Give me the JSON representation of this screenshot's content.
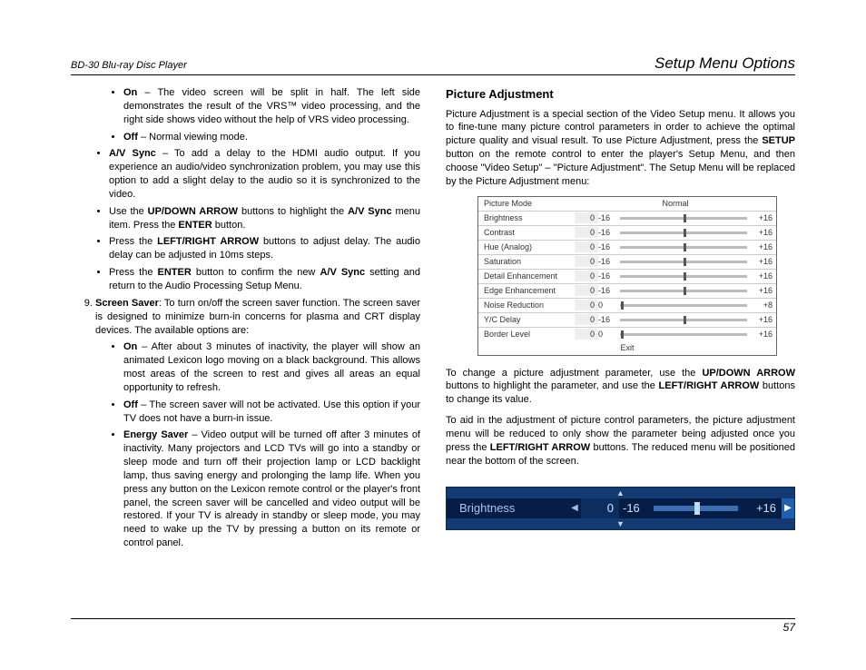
{
  "header": {
    "left": "BD-30 Blu-ray Disc Player",
    "right": "Setup Menu Options"
  },
  "left_col": {
    "bullets1": {
      "on_bold": "On",
      "on_text": " – The video screen will be split in half. The left side demonstrates the result of the VRS™ video processing, and the right side shows video without the help of VRS video processing.",
      "off_bold": "Off",
      "off_text": " – Normal viewing mode."
    },
    "bullets2": {
      "av_bold": "A/V Sync",
      "av_text": " – To add a delay to the HDMI audio output. If you experience an audio/video synchronization problem, you may use this option to add a slight delay to the audio so it is synchronized to the video.",
      "use_pre": "Use the ",
      "use_bold1": "UP/DOWN ARROW",
      "use_mid": " buttons to highlight the ",
      "use_bold2": "A/V Sync",
      "use_post": " menu item. Press the ",
      "use_bold3": "ENTER",
      "use_end": " button.",
      "press_pre": "Press the ",
      "press_bold": "LEFT/RIGHT ARROW",
      "press_post": " buttons to adjust delay. The audio delay can be adjusted in 10ms steps.",
      "conf_pre": "Press the ",
      "conf_bold1": "ENTER",
      "conf_mid": " button to confirm the new ",
      "conf_bold2": "A/V Sync",
      "conf_post": " setting and return to the Audio Processing Setup Menu."
    },
    "item9": {
      "ss_bold": "Screen Saver",
      "ss_text": ": To turn on/off the screen saver function. The screen saver is designed to minimize burn-in concerns for plasma and CRT display devices. The available options are:",
      "on_bold": "On",
      "on_text": " – After about 3 minutes of inactivity, the player will show an animated Lexicon logo moving on a black background. This allows most areas of the screen to rest and gives all areas an equal opportunity to refresh.",
      "off_bold": "Off",
      "off_text": " – The screen saver will not be activated. Use this option if your TV does not have a burn-in issue.",
      "es_bold": "Energy Saver",
      "es_text": " – Video output will be turned off after 3 minutes of inactivity. Many projectors and LCD TVs will go into a standby or sleep mode and turn off their projection lamp or LCD backlight lamp, thus saving energy and prolonging the lamp life. When you press any button on the Lexicon remote control or the player's front panel, the screen saver will be cancelled and video output will be restored. If your TV is already in standby or sleep mode, you may need to wake up the TV by pressing a button on its remote or control panel."
    }
  },
  "right_col": {
    "title": "Picture Adjustment",
    "p1_pre": "Picture Adjustment is a special section of the Video Setup menu. It allows you to fine-tune many picture control parameters in order to achieve the optimal picture quality and visual result. To use Picture Adjustment, press the ",
    "p1_b1": "SETUP",
    "p1_post": " button on the remote control to enter the player's Setup Menu, and then choose \"Video Setup\" – \"Picture Adjustment\". The Setup Menu will be replaced by the Picture Adjustment menu:",
    "table": {
      "mode_label": "Picture Mode",
      "mode_value": "Normal",
      "rows": [
        {
          "label": "Brightness",
          "val": "0",
          "min": "-16",
          "max": "+16",
          "pos": 50
        },
        {
          "label": "Contrast",
          "val": "0",
          "min": "-16",
          "max": "+16",
          "pos": 50
        },
        {
          "label": "Hue (Analog)",
          "val": "0",
          "min": "-16",
          "max": "+16",
          "pos": 50
        },
        {
          "label": "Saturation",
          "val": "0",
          "min": "-16",
          "max": "+16",
          "pos": 50
        },
        {
          "label": "Detail Enhancement",
          "val": "0",
          "min": "-16",
          "max": "+16",
          "pos": 50
        },
        {
          "label": "Edge Enhancement",
          "val": "0",
          "min": "-16",
          "max": "+16",
          "pos": 50
        },
        {
          "label": "Noise Reduction",
          "val": "0",
          "min": "0",
          "max": "+8",
          "pos": 1
        },
        {
          "label": "Y/C Delay",
          "val": "0",
          "min": "-16",
          "max": "+16",
          "pos": 50
        },
        {
          "label": "Border Level",
          "val": "0",
          "min": "0",
          "max": "+16",
          "pos": 1
        }
      ],
      "exit": "Exit"
    },
    "p2_pre": "To change a picture adjustment parameter, use the ",
    "p2_b1": "UP/DOWN ARROW",
    "p2_mid": " buttons to highlight the parameter, and use the ",
    "p2_b2": "LEFT/RIGHT ARROW",
    "p2_post": " buttons to change its value.",
    "p3_pre": "To aid in the adjustment of picture control parameters, the picture adjustment menu will be reduced to only show the parameter being adjusted once you press the ",
    "p3_b1": "LEFT/RIGHT ARROW",
    "p3_post": " buttons. The reduced menu will be positioned near the bottom of the screen.",
    "reduced": {
      "label": "Brightness",
      "val": "0",
      "min": "-16",
      "max": "+16"
    }
  },
  "footer": {
    "page": "57"
  }
}
